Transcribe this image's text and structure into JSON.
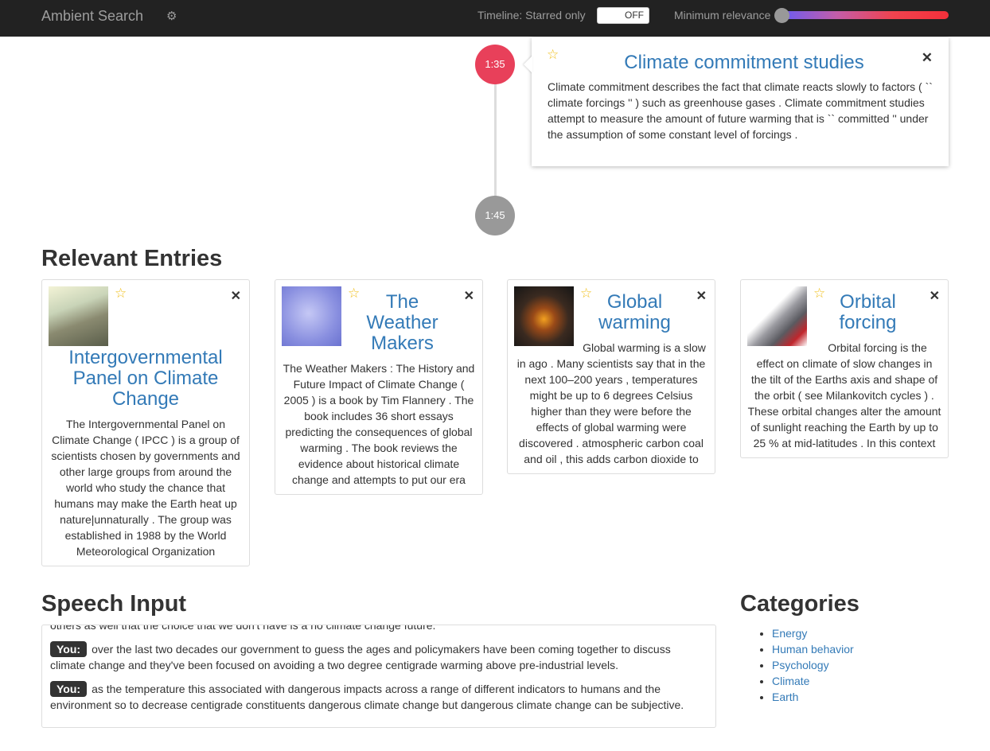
{
  "navbar": {
    "brand": "Ambient Search",
    "timeline_label": "Timeline: Starred only",
    "toggle_state": "OFF",
    "relevance_label": "Minimum relevance",
    "relevance_value": 0.0
  },
  "timeline": {
    "marker_1": "1:35",
    "marker_2": "1:45",
    "card": {
      "title": "Climate commitment studies",
      "text": "Climate commitment describes the fact that climate reacts slowly to factors ( `` climate forcings '' ) such as greenhouse gases . Climate commitment studies attempt to measure the amount of future warming that is `` committed '' under the assumption of some constant level of forcings ."
    }
  },
  "relevant": {
    "heading": "Relevant Entries",
    "entries": [
      {
        "title": "Intergovernmental Panel on Climate Change",
        "text": "The Intergovernmental Panel on Climate Change ( IPCC ) is a group of scientists chosen by governments and other large groups from around the world who study the chance that humans may make the Earth heat up nature|unnaturally . The group was established in 1988 by the World Meteorological Organization"
      },
      {
        "title": "The Weather Makers",
        "text": "The Weather Makers : The History and Future Impact of Climate Change ( 2005 ) is a book by Tim Flannery . The book includes 36 short essays predicting the consequences of global warming . The book reviews the evidence about historical climate change and attempts to put our era"
      },
      {
        "title": "Global warming",
        "text": "Global warming is a slow in ago . Many scientists say that in the next 100–200 years , temperatures might be up to 6 degrees Celsius higher than they were before the effects of global warming were discovered . atmospheric carbon coal and oil , this adds carbon dioxide to"
      },
      {
        "title": "Orbital forcing",
        "text": "Orbital forcing is the effect on climate of slow changes in the tilt of the Earths axis and shape of the orbit ( see Milankovitch cycles ) . These orbital changes alter the amount of sunlight reaching the Earth by up to 25 % at mid-latitudes . In this context"
      }
    ]
  },
  "speech": {
    "heading": "Speech Input",
    "partial_line": "others as well that the choice that we don't have is a no climate change future.",
    "speaker_label": "You:",
    "utterances": [
      "over the last two decades our government to guess the ages and policymakers have been coming together to discuss climate change and they've been focused on avoiding a two degree centigrade warming above pre-industrial levels.",
      "as the temperature this associated with dangerous impacts across a range of different indicators to humans and the environment so to decrease centigrade constituents dangerous climate change but dangerous climate change can be subjective."
    ]
  },
  "categories": {
    "heading": "Categories",
    "items": [
      "Energy",
      "Human behavior",
      "Psychology",
      "Climate",
      "Earth"
    ]
  }
}
